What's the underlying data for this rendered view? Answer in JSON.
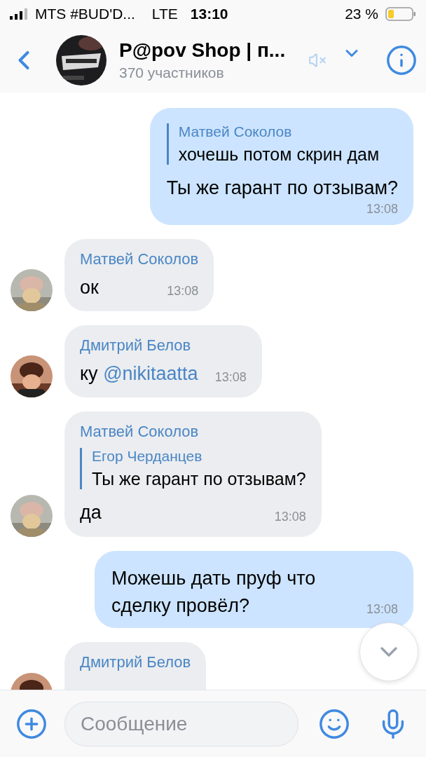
{
  "status_bar": {
    "carrier": "MTS #BUD'D...",
    "network": "LTE",
    "time": "13:10",
    "battery": "23 %"
  },
  "header": {
    "title": "P@pov Shop | п...",
    "subtitle": "370 участников",
    "muted": true
  },
  "messages": [
    {
      "kind": "outgoing",
      "reply": {
        "author": "Матвей Соколов",
        "text": "хочешь потом скрин дам"
      },
      "text": "Ты же гарант по отзывам?",
      "time": "13:08"
    },
    {
      "kind": "incoming",
      "sender": "Матвей Соколов",
      "text": "ок",
      "time": "13:08"
    },
    {
      "kind": "incoming",
      "sender": "Дмитрий Белов",
      "text": "ку",
      "mention": "@nikitaatta",
      "time": "13:08"
    },
    {
      "kind": "incoming",
      "sender": "Матвей Соколов",
      "reply": {
        "author": "Егор Черданцев",
        "text": "Ты же гарант по отзывам?"
      },
      "text": "да",
      "time": "13:08"
    },
    {
      "kind": "outgoing",
      "text": "Можешь дать пруф что сделку провёл?",
      "time": "13:08"
    },
    {
      "kind": "incoming",
      "sender": "Дмитрий Белов"
    }
  ],
  "composer": {
    "placeholder": "Сообщение"
  }
}
